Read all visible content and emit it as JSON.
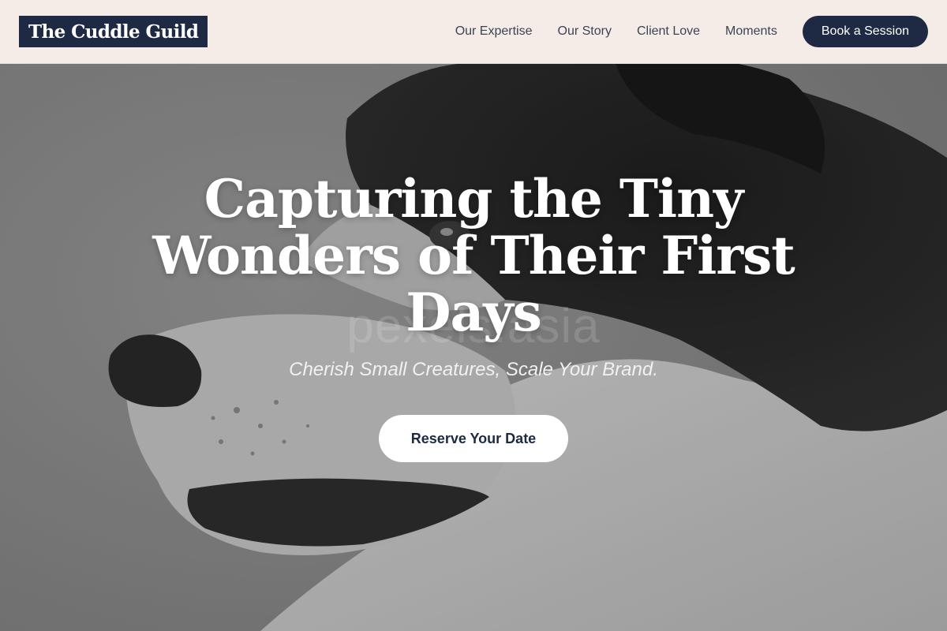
{
  "brand": {
    "logo_text": "The Cuddle Guild"
  },
  "nav": {
    "links": [
      {
        "label": "Our Expertise"
      },
      {
        "label": "Our Story"
      },
      {
        "label": "Client Love"
      },
      {
        "label": "Moments"
      }
    ],
    "cta_label": "Book a Session"
  },
  "hero": {
    "title": "Capturing the Tiny Wonders of Their First Days",
    "subtitle": "Cherish Small Creatures, Scale Your Brand.",
    "button_label": "Reserve Your Date",
    "watermark_text": "pexels.asia",
    "image_subject": "grayscale-dog-profile-photo"
  },
  "colors": {
    "navy": "#1e2a44",
    "header_bg": "#f5ece8",
    "nav_text": "#3c4354",
    "white": "#ffffff"
  }
}
